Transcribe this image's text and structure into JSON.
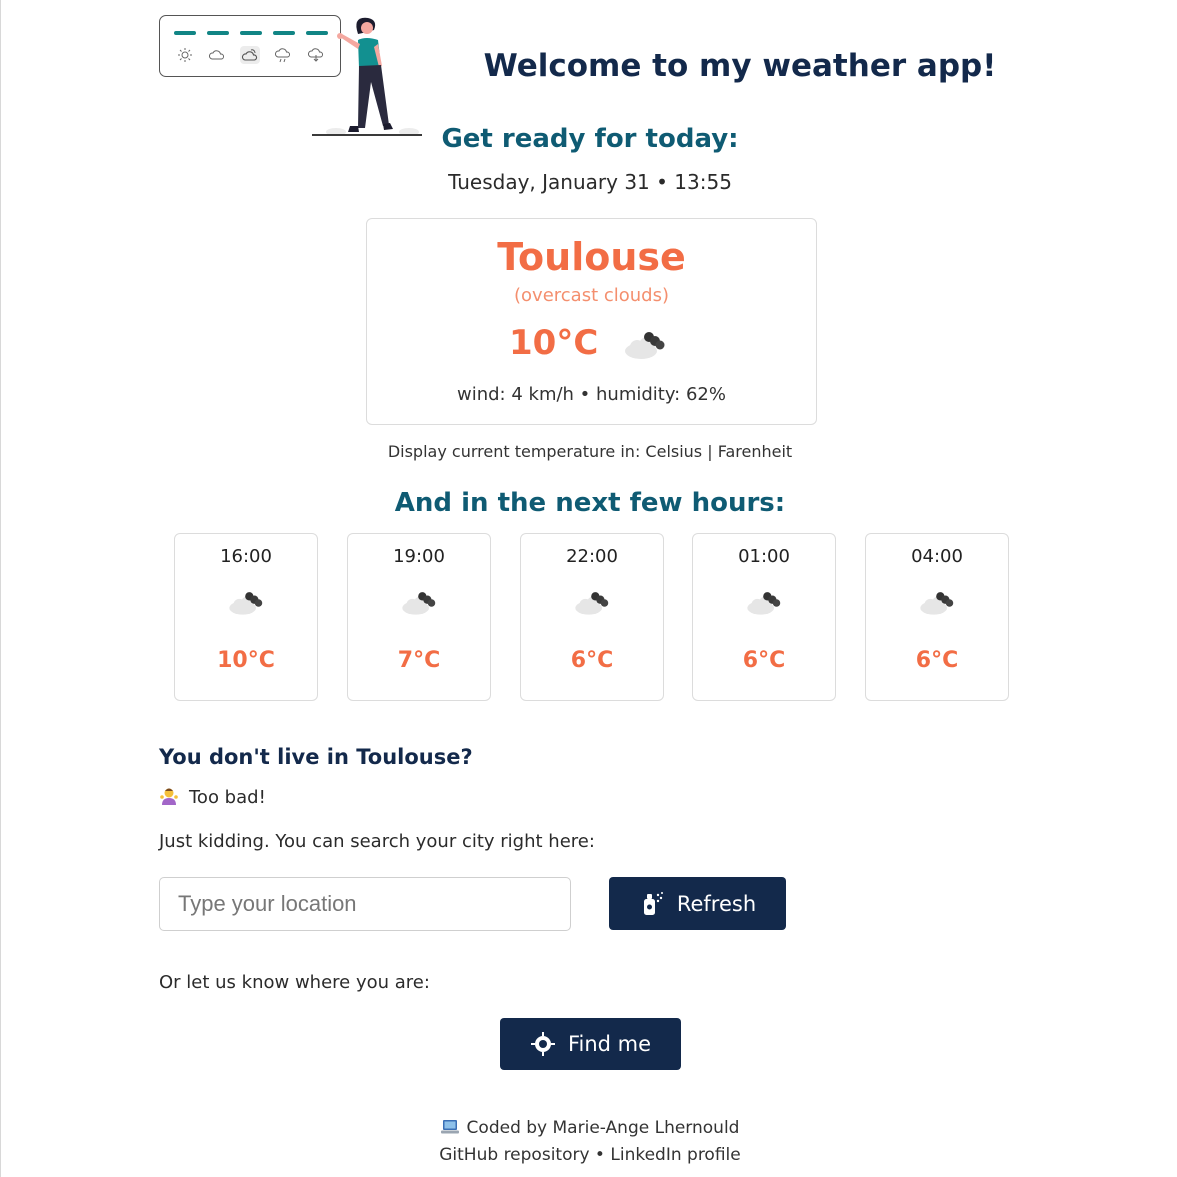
{
  "header": {
    "title": "Welcome to my weather app!",
    "subtitle": "Get ready for today:",
    "datetime": "Tuesday, January 31 • 13:55"
  },
  "current": {
    "city": "Toulouse",
    "description": "(overcast clouds)",
    "temperature": "10°C",
    "icon": "overcast-clouds-icon",
    "wind_humidity": "wind: 4 km/h • humidity: 62%"
  },
  "units": {
    "prefix": "Display current temperature in: ",
    "celsius": "Celsius",
    "separator": " | ",
    "fahrenheit": "Farenheit"
  },
  "forecast": {
    "title": "And in the next few hours:",
    "items": [
      {
        "time": "16:00",
        "temp": "10°C",
        "icon": "overcast-clouds-icon"
      },
      {
        "time": "19:00",
        "temp": "7°C",
        "icon": "overcast-clouds-icon"
      },
      {
        "time": "22:00",
        "temp": "6°C",
        "icon": "overcast-clouds-icon"
      },
      {
        "time": "01:00",
        "temp": "6°C",
        "icon": "overcast-clouds-icon"
      },
      {
        "time": "04:00",
        "temp": "6°C",
        "icon": "overcast-clouds-icon"
      }
    ]
  },
  "search": {
    "question": "You don't live in Toulouse?",
    "too_bad": "Too bad!",
    "prompt": "Just kidding. You can search your city right here:",
    "placeholder": "Type your location",
    "refresh_label": "Refresh",
    "locate_prompt": "Or let us know where you are:",
    "find_me_label": "Find me"
  },
  "footer": {
    "coded_by": "Coded by Marie-Ange Lhernould",
    "github": "GitHub repository",
    "separator": " • ",
    "linkedin": "LinkedIn profile"
  },
  "colors": {
    "navy": "#13294b",
    "teal": "#0f5b73",
    "accent": "#f26d45"
  }
}
